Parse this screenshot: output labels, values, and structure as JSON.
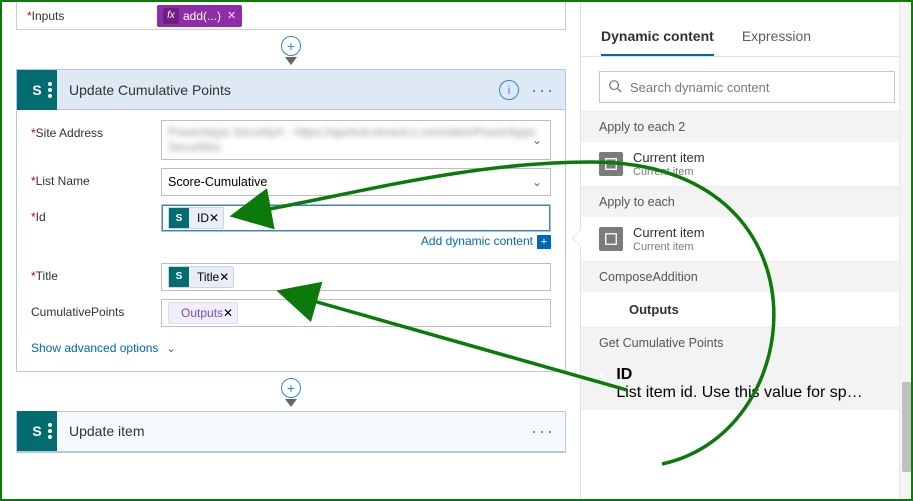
{
  "top": {
    "inputs_label": "Inputs",
    "fx_label": "add(...)"
  },
  "card_update": {
    "title": "Update Cumulative Points",
    "fields": {
      "site_address_label": "Site Address",
      "site_address_value": "PowerApps SecurityX - https://apxhub.tenant-x.com/sites/PowerApps Securities",
      "list_name_label": "List Name",
      "list_name_value": "Score-Cumulative",
      "id_label": "Id",
      "id_token": "ID",
      "title_label": "Title",
      "title_token": "Title",
      "cum_label": "CumulativePoints",
      "cum_token": "Outputs"
    },
    "add_dynamic": "Add dynamic content",
    "advanced": "Show advanced options"
  },
  "card_item": {
    "title": "Update item"
  },
  "panel": {
    "tab_dynamic": "Dynamic content",
    "tab_expr": "Expression",
    "search_placeholder": "Search dynamic content",
    "groups": {
      "g1": "Apply to each 2",
      "g1_item": "Current item",
      "g1_sub": "Current item",
      "g2": "Apply to each",
      "g2_item": "Current item",
      "g2_sub": "Current item",
      "g3": "ComposeAddition",
      "g3_item": "Outputs",
      "g4": "Get Cumulative Points",
      "g4_item": "ID",
      "g4_sub": "List item id. Use this value for specifying the item to act o..."
    }
  }
}
